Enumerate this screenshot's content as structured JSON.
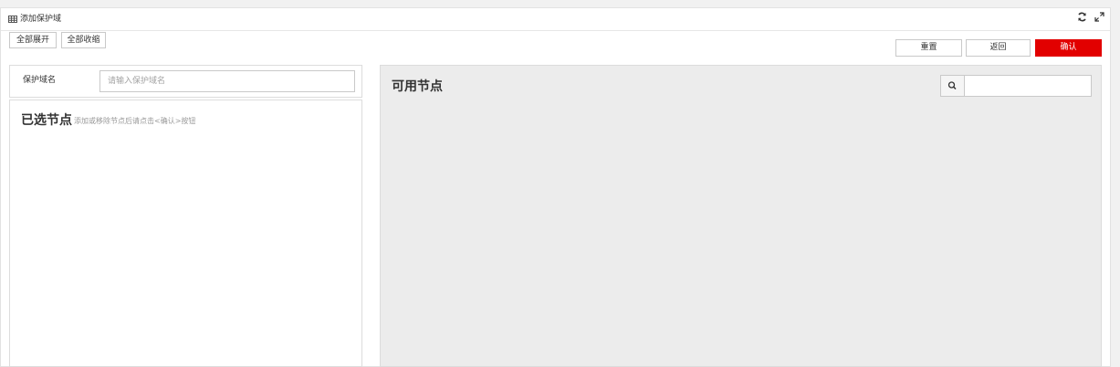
{
  "header": {
    "title": "添加保护域",
    "icons": [
      "table-icon",
      "refresh-icon",
      "expand-icon"
    ]
  },
  "toolbar": {
    "expand_all": "全部展开",
    "collapse_all": "全部收缩",
    "reset": "重置",
    "back": "返回",
    "confirm": "确认"
  },
  "form": {
    "domain_label": "保护域名",
    "domain_placeholder": "请输入保护域名",
    "domain_value": ""
  },
  "selected": {
    "title": "已选节点",
    "hint": "添加或移除节点后请点击<确认>按钮"
  },
  "available": {
    "title": "可用节点",
    "search_value": ""
  },
  "colors": {
    "confirm": "#e20000",
    "panel_bg": "#ececec"
  }
}
